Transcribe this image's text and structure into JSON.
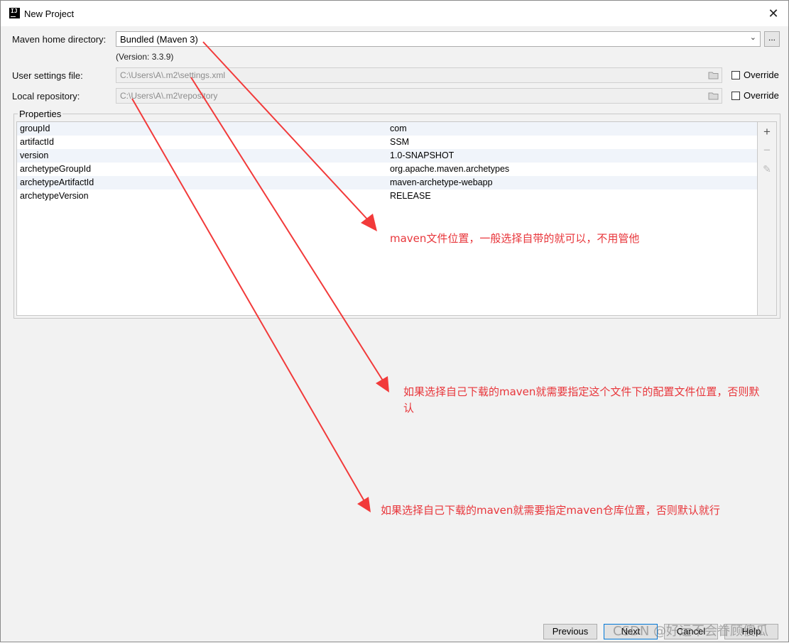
{
  "window": {
    "title": "New Project"
  },
  "maven_home": {
    "label": "Maven home directory:",
    "value": "Bundled (Maven 3)",
    "version": "(Version: 3.3.9)",
    "browse_label": "..."
  },
  "user_settings": {
    "label": "User settings file:",
    "path": "C:\\Users\\A\\.m2\\settings.xml",
    "override_label": "Override"
  },
  "local_repo": {
    "label": "Local repository:",
    "path": "C:\\Users\\A\\.m2\\repository",
    "override_label": "Override"
  },
  "properties": {
    "title": "Properties",
    "rows": [
      {
        "key": "groupId",
        "value": "com"
      },
      {
        "key": "artifactId",
        "value": "SSM"
      },
      {
        "key": "version",
        "value": "1.0-SNAPSHOT"
      },
      {
        "key": "archetypeGroupId",
        "value": "org.apache.maven.archetypes"
      },
      {
        "key": "archetypeArtifactId",
        "value": "maven-archetype-webapp"
      },
      {
        "key": "archetypeVersion",
        "value": "RELEASE"
      }
    ]
  },
  "annotations": {
    "a1": "maven文件位置，一般选择自带的就可以，不用管他",
    "a2_line1": "如果选择自己下载的maven就需要指定这个文件下的配置文件位置，否则默",
    "a2_line2": "认",
    "a3": "如果选择自己下载的maven就需要指定maven仓库位置，否则默认就行"
  },
  "footer": {
    "previous": "Previous",
    "next": "Next",
    "cancel": "Cancel",
    "help": "Help"
  },
  "watermark": "CSDN @好运不会眷顾傻瓜",
  "colors": {
    "annotation_red": "#e8363b",
    "focus_blue": "#0078d7"
  }
}
